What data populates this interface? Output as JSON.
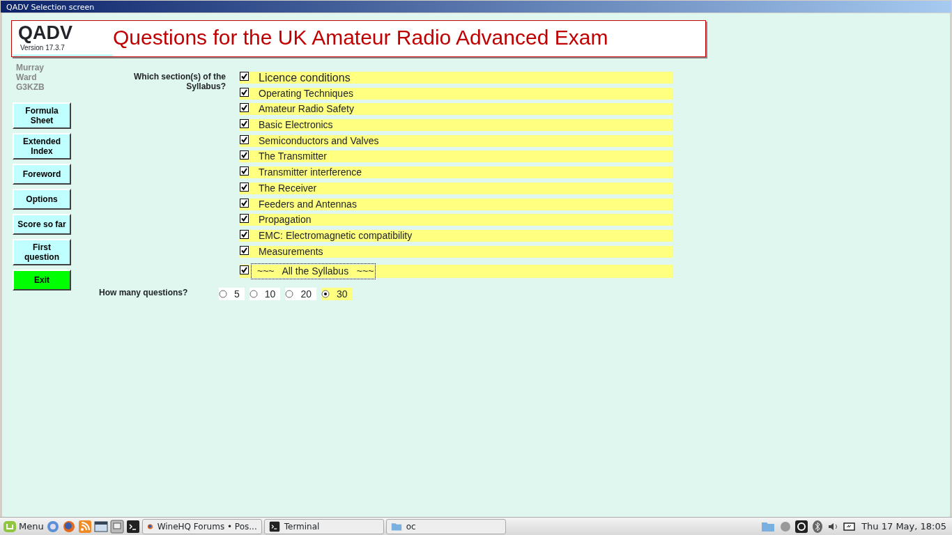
{
  "window": {
    "title": "QADV Selection screen"
  },
  "header": {
    "logo": "QADV",
    "version": "Version 17.3.7",
    "title": "Questions for the UK Amateur Radio Advanced Exam"
  },
  "author": [
    "Murray",
    "Ward",
    "G3KZB"
  ],
  "sidebar": {
    "buttons": [
      {
        "label": "Formula Sheet",
        "kind": "normal"
      },
      {
        "label": "Extended Index",
        "kind": "normal"
      },
      {
        "label": "Foreword",
        "kind": "normal"
      },
      {
        "label": "Options",
        "kind": "normal"
      },
      {
        "label": "Score so far",
        "kind": "normal"
      },
      {
        "label": "First question",
        "kind": "normal"
      },
      {
        "label": "Exit",
        "kind": "exit"
      }
    ]
  },
  "sections_label": "Which section(s) of the Syllabus?",
  "sections": [
    {
      "label": "Licence conditions",
      "checked": true
    },
    {
      "label": "Operating Techniques",
      "checked": true
    },
    {
      "label": "Amateur Radio Safety",
      "checked": true
    },
    {
      "label": "Basic Electronics",
      "checked": true
    },
    {
      "label": "Semiconductors and Valves",
      "checked": true
    },
    {
      "label": "The Transmitter",
      "checked": true
    },
    {
      "label": "Transmitter interference",
      "checked": true
    },
    {
      "label": "The Receiver",
      "checked": true
    },
    {
      "label": "Feeders and Antennas",
      "checked": true
    },
    {
      "label": "Propagation",
      "checked": true
    },
    {
      "label": "EMC: Electromagnetic compatibility",
      "checked": true
    },
    {
      "label": "Measurements",
      "checked": true
    }
  ],
  "all_syllabus": {
    "label": "~~~   All the Syllabus   ~~~",
    "checked": true,
    "focused": true
  },
  "questions_label": "How many questions?",
  "question_counts": [
    {
      "label": "5",
      "selected": false
    },
    {
      "label": "10",
      "selected": false
    },
    {
      "label": "20",
      "selected": false
    },
    {
      "label": "30",
      "selected": true
    }
  ],
  "taskbar": {
    "menu": "Menu",
    "tasks": [
      {
        "label": "WineHQ Forums • Pos...",
        "kind": "browser"
      },
      {
        "label": "Terminal",
        "kind": "terminal"
      },
      {
        "label": "oc",
        "kind": "folder"
      }
    ],
    "clock": "Thu 17 May, 18:05"
  }
}
